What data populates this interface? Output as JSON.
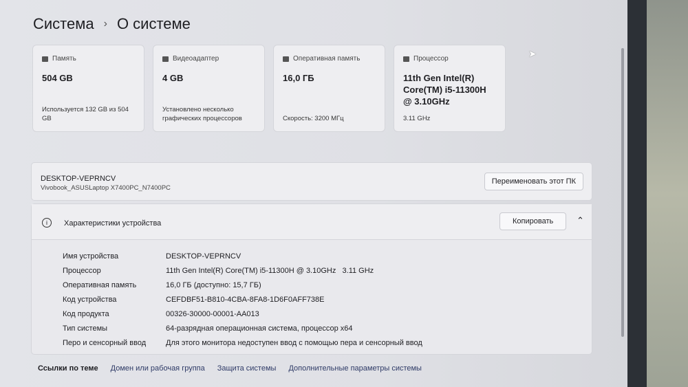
{
  "breadcrumb": {
    "parent": "Система",
    "current": "О системе"
  },
  "cards": [
    {
      "title": "Память",
      "value": "504 GB",
      "sub": "Используется 132 GB из 504 GB"
    },
    {
      "title": "Видеоадаптер",
      "value": "4 GB",
      "sub": "Установлено несколько графических процессоров"
    },
    {
      "title": "Оперативная память",
      "value": "16,0 ГБ",
      "sub": "Скорость: 3200 МГц"
    },
    {
      "title": "Процессор",
      "value": "11th Gen Intel(R) Core(TM) i5-11300H @ 3.10GHz",
      "sub": "3.11 GHz"
    }
  ],
  "device": {
    "name": "DESKTOP-VEPRNCV",
    "model": "Vivobook_ASUSLaptop X7400PC_N7400PC",
    "rename_label": "Переименовать этот ПК"
  },
  "specs": {
    "title": "Характеристики устройства",
    "copy_label": "Копировать",
    "rows": [
      {
        "k": "Имя устройства",
        "v": "DESKTOP-VEPRNCV"
      },
      {
        "k": "Процессор",
        "v": "11th Gen Intel(R) Core(TM) i5-11300H @ 3.10GHz   3.11 GHz"
      },
      {
        "k": "Оперативная память",
        "v": "16,0 ГБ (доступно: 15,7 ГБ)"
      },
      {
        "k": "Код устройства",
        "v": "CEFDBF51-B810-4CBA-8FA8-1D6F0AFF738E"
      },
      {
        "k": "Код продукта",
        "v": "00326-30000-00001-AA013"
      },
      {
        "k": "Тип системы",
        "v": "64-разрядная операционная система, процессор x64"
      },
      {
        "k": "Перо и сенсорный ввод",
        "v": "Для этого монитора недоступен ввод с помощью пера и сенсорный ввод"
      }
    ]
  },
  "links": {
    "label": "Ссылки по теме",
    "items": [
      "Домен или рабочая группа",
      "Защита системы",
      "Дополнительные параметры системы"
    ]
  }
}
